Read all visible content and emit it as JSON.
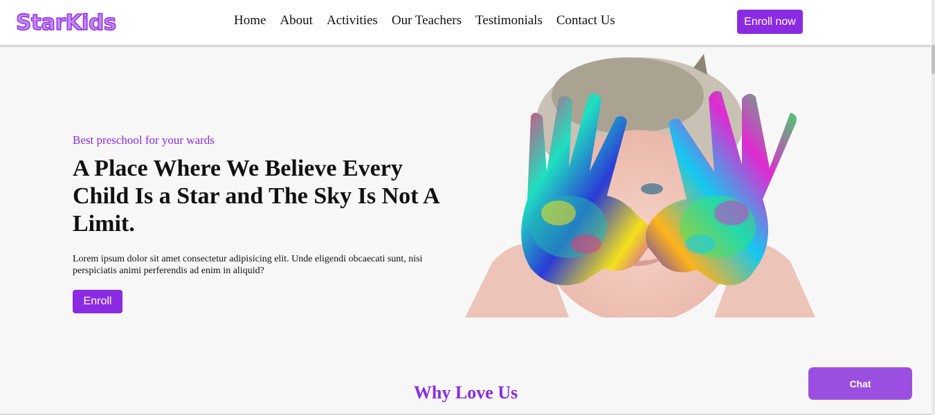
{
  "brand": {
    "logo_text": "StarKids",
    "accent_color": "#8a2be2"
  },
  "nav": {
    "items": [
      {
        "label": "Home"
      },
      {
        "label": "About"
      },
      {
        "label": "Activities"
      },
      {
        "label": "Our Teachers"
      },
      {
        "label": "Testimonials"
      },
      {
        "label": "Contact Us"
      }
    ],
    "cta_label": "Enroll now"
  },
  "hero": {
    "eyebrow": "Best preschool for your wards",
    "title": "A Place Where We Believe Every Child Is a Star and The Sky Is Not A Limit.",
    "description": "Lorem ipsum dolor sit amet consectetur adipisicing elit. Unde eligendi obcaecati sunt, nisi perspiciatis animi perferendis ad enim in aliquid?",
    "button_label": "Enroll",
    "image_icon": "child-painted-hands-photo"
  },
  "section": {
    "title": "Why Love Us"
  },
  "chat": {
    "label": "Chat"
  }
}
